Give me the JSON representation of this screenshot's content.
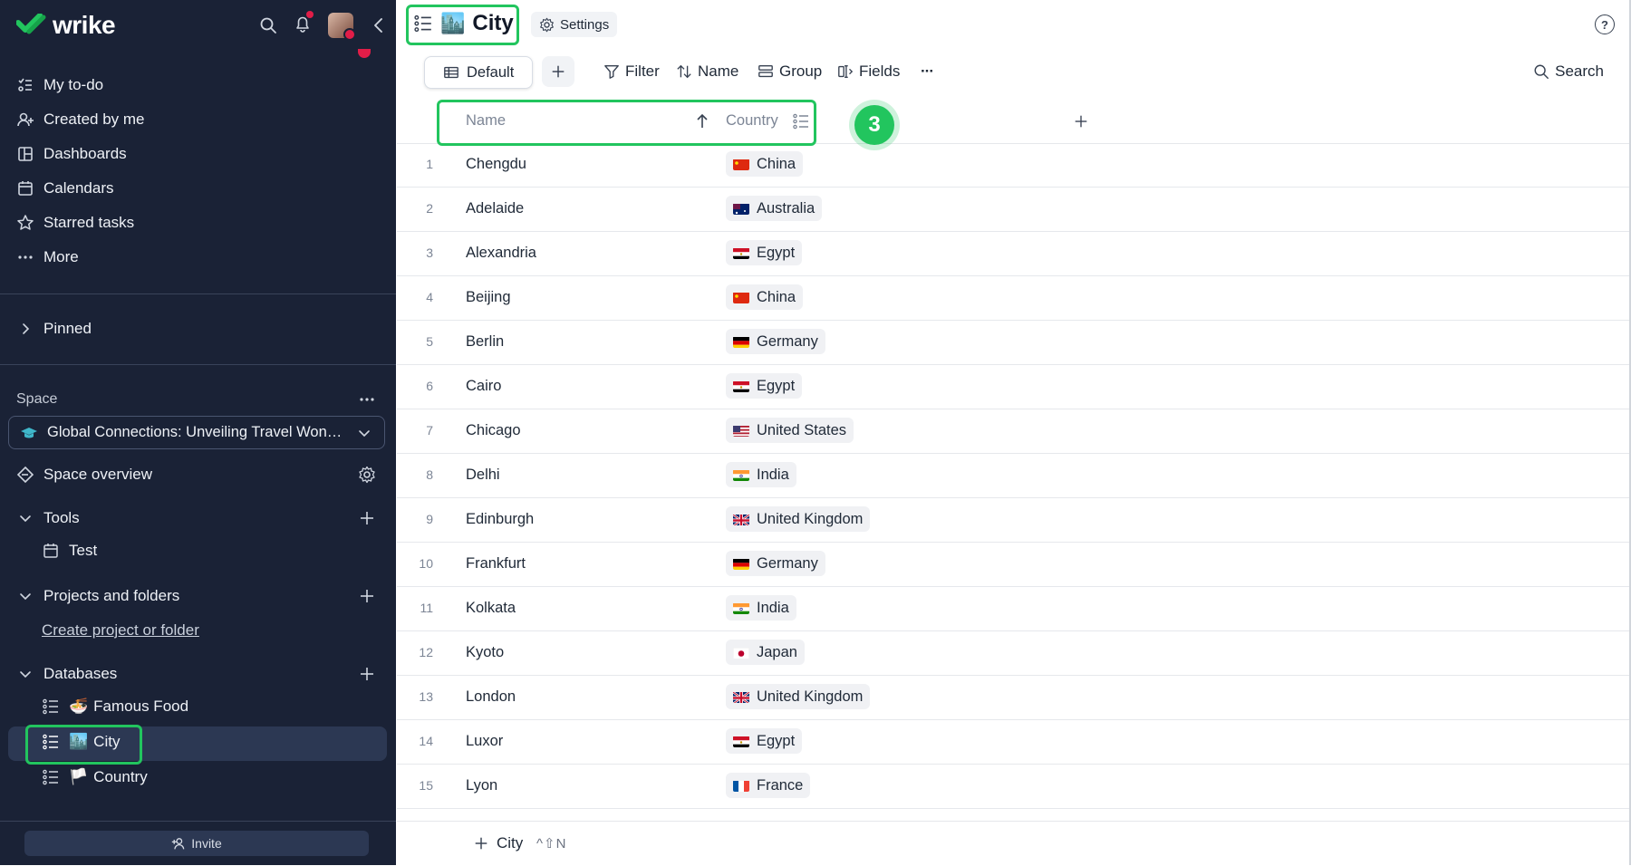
{
  "brand": {
    "name": "wrike"
  },
  "sidebar": {
    "nav": [
      {
        "label": "My to-do",
        "icon": "todo-list-icon"
      },
      {
        "label": "Created by me",
        "icon": "user-plus-icon"
      },
      {
        "label": "Dashboards",
        "icon": "dashboard-icon"
      },
      {
        "label": "Calendars",
        "icon": "calendar-icon"
      },
      {
        "label": "Starred tasks",
        "icon": "star-icon"
      },
      {
        "label": "More",
        "icon": "more-icon"
      }
    ],
    "pinned": "Pinned",
    "space_label": "Space",
    "space_name": "Global Connections: Unveiling Travel Wond...",
    "space_overview": "Space overview",
    "tools_label": "Tools",
    "tools_items": [
      {
        "label": "Test"
      }
    ],
    "projects_label": "Projects and folders",
    "create_project": "Create project or folder",
    "databases_label": "Databases",
    "databases": [
      {
        "emoji": "🍜",
        "label": "Famous Food"
      },
      {
        "emoji": "🏙️",
        "label": "City"
      },
      {
        "emoji": "🏳️",
        "label": "Country"
      }
    ],
    "invite": "Invite"
  },
  "header": {
    "title_emoji": "🏙️",
    "title": "City",
    "settings": "Settings",
    "help": "?"
  },
  "toolbar": {
    "view": "Default",
    "filter": "Filter",
    "sort": "Name",
    "group": "Group",
    "fields": "Fields",
    "more": "···",
    "search": "Search"
  },
  "table": {
    "columns": {
      "name": "Name",
      "country": "Country"
    },
    "rows": [
      {
        "n": "1",
        "city": "Chengdu",
        "country": "China",
        "flag": "cn"
      },
      {
        "n": "2",
        "city": "Adelaide",
        "country": "Australia",
        "flag": "au"
      },
      {
        "n": "3",
        "city": "Alexandria",
        "country": "Egypt",
        "flag": "eg"
      },
      {
        "n": "4",
        "city": "Beijing",
        "country": "China",
        "flag": "cn"
      },
      {
        "n": "5",
        "city": "Berlin",
        "country": "Germany",
        "flag": "de"
      },
      {
        "n": "6",
        "city": "Cairo",
        "country": "Egypt",
        "flag": "eg"
      },
      {
        "n": "7",
        "city": "Chicago",
        "country": "United States",
        "flag": "us"
      },
      {
        "n": "8",
        "city": "Delhi",
        "country": "India",
        "flag": "in"
      },
      {
        "n": "9",
        "city": "Edinburgh",
        "country": "United Kingdom",
        "flag": "gb"
      },
      {
        "n": "10",
        "city": "Frankfurt",
        "country": "Germany",
        "flag": "de"
      },
      {
        "n": "11",
        "city": "Kolkata",
        "country": "India",
        "flag": "in"
      },
      {
        "n": "12",
        "city": "Kyoto",
        "country": "Japan",
        "flag": "jp"
      },
      {
        "n": "13",
        "city": "London",
        "country": "United Kingdom",
        "flag": "gb"
      },
      {
        "n": "14",
        "city": "Luxor",
        "country": "Egypt",
        "flag": "eg"
      },
      {
        "n": "15",
        "city": "Lyon",
        "country": "France",
        "flag": "fr"
      }
    ]
  },
  "footer": {
    "add_label": "City",
    "shortcut": "^⇧N"
  },
  "step_badge": "3",
  "colors": {
    "sidebar_bg": "#1a2236",
    "highlight": "#22c55e",
    "chip_bg": "#f0f1f4"
  }
}
